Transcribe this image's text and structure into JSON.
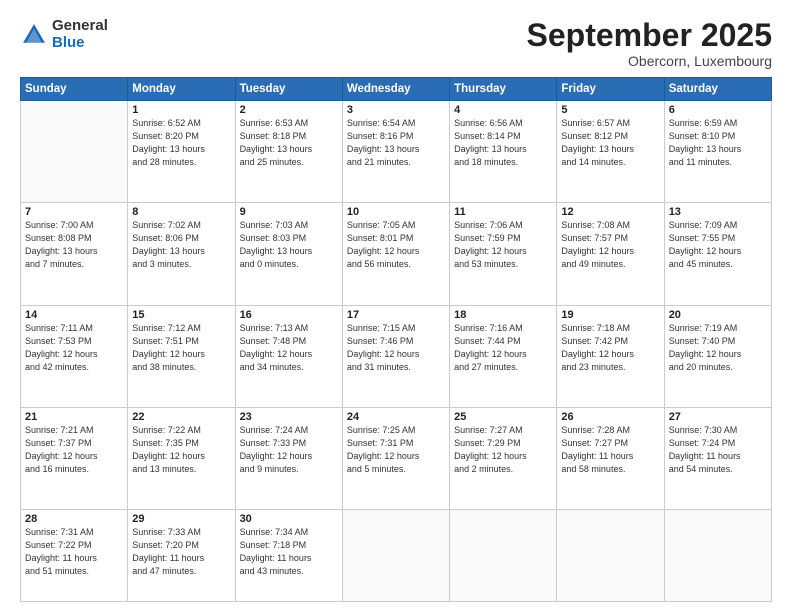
{
  "logo": {
    "general": "General",
    "blue": "Blue"
  },
  "header": {
    "month": "September 2025",
    "location": "Obercorn, Luxembourg"
  },
  "days_of_week": [
    "Sunday",
    "Monday",
    "Tuesday",
    "Wednesday",
    "Thursday",
    "Friday",
    "Saturday"
  ],
  "weeks": [
    [
      {
        "day": "",
        "info": ""
      },
      {
        "day": "1",
        "info": "Sunrise: 6:52 AM\nSunset: 8:20 PM\nDaylight: 13 hours\nand 28 minutes."
      },
      {
        "day": "2",
        "info": "Sunrise: 6:53 AM\nSunset: 8:18 PM\nDaylight: 13 hours\nand 25 minutes."
      },
      {
        "day": "3",
        "info": "Sunrise: 6:54 AM\nSunset: 8:16 PM\nDaylight: 13 hours\nand 21 minutes."
      },
      {
        "day": "4",
        "info": "Sunrise: 6:56 AM\nSunset: 8:14 PM\nDaylight: 13 hours\nand 18 minutes."
      },
      {
        "day": "5",
        "info": "Sunrise: 6:57 AM\nSunset: 8:12 PM\nDaylight: 13 hours\nand 14 minutes."
      },
      {
        "day": "6",
        "info": "Sunrise: 6:59 AM\nSunset: 8:10 PM\nDaylight: 13 hours\nand 11 minutes."
      }
    ],
    [
      {
        "day": "7",
        "info": "Sunrise: 7:00 AM\nSunset: 8:08 PM\nDaylight: 13 hours\nand 7 minutes."
      },
      {
        "day": "8",
        "info": "Sunrise: 7:02 AM\nSunset: 8:06 PM\nDaylight: 13 hours\nand 3 minutes."
      },
      {
        "day": "9",
        "info": "Sunrise: 7:03 AM\nSunset: 8:03 PM\nDaylight: 13 hours\nand 0 minutes."
      },
      {
        "day": "10",
        "info": "Sunrise: 7:05 AM\nSunset: 8:01 PM\nDaylight: 12 hours\nand 56 minutes."
      },
      {
        "day": "11",
        "info": "Sunrise: 7:06 AM\nSunset: 7:59 PM\nDaylight: 12 hours\nand 53 minutes."
      },
      {
        "day": "12",
        "info": "Sunrise: 7:08 AM\nSunset: 7:57 PM\nDaylight: 12 hours\nand 49 minutes."
      },
      {
        "day": "13",
        "info": "Sunrise: 7:09 AM\nSunset: 7:55 PM\nDaylight: 12 hours\nand 45 minutes."
      }
    ],
    [
      {
        "day": "14",
        "info": "Sunrise: 7:11 AM\nSunset: 7:53 PM\nDaylight: 12 hours\nand 42 minutes."
      },
      {
        "day": "15",
        "info": "Sunrise: 7:12 AM\nSunset: 7:51 PM\nDaylight: 12 hours\nand 38 minutes."
      },
      {
        "day": "16",
        "info": "Sunrise: 7:13 AM\nSunset: 7:48 PM\nDaylight: 12 hours\nand 34 minutes."
      },
      {
        "day": "17",
        "info": "Sunrise: 7:15 AM\nSunset: 7:46 PM\nDaylight: 12 hours\nand 31 minutes."
      },
      {
        "day": "18",
        "info": "Sunrise: 7:16 AM\nSunset: 7:44 PM\nDaylight: 12 hours\nand 27 minutes."
      },
      {
        "day": "19",
        "info": "Sunrise: 7:18 AM\nSunset: 7:42 PM\nDaylight: 12 hours\nand 23 minutes."
      },
      {
        "day": "20",
        "info": "Sunrise: 7:19 AM\nSunset: 7:40 PM\nDaylight: 12 hours\nand 20 minutes."
      }
    ],
    [
      {
        "day": "21",
        "info": "Sunrise: 7:21 AM\nSunset: 7:37 PM\nDaylight: 12 hours\nand 16 minutes."
      },
      {
        "day": "22",
        "info": "Sunrise: 7:22 AM\nSunset: 7:35 PM\nDaylight: 12 hours\nand 13 minutes."
      },
      {
        "day": "23",
        "info": "Sunrise: 7:24 AM\nSunset: 7:33 PM\nDaylight: 12 hours\nand 9 minutes."
      },
      {
        "day": "24",
        "info": "Sunrise: 7:25 AM\nSunset: 7:31 PM\nDaylight: 12 hours\nand 5 minutes."
      },
      {
        "day": "25",
        "info": "Sunrise: 7:27 AM\nSunset: 7:29 PM\nDaylight: 12 hours\nand 2 minutes."
      },
      {
        "day": "26",
        "info": "Sunrise: 7:28 AM\nSunset: 7:27 PM\nDaylight: 11 hours\nand 58 minutes."
      },
      {
        "day": "27",
        "info": "Sunrise: 7:30 AM\nSunset: 7:24 PM\nDaylight: 11 hours\nand 54 minutes."
      }
    ],
    [
      {
        "day": "28",
        "info": "Sunrise: 7:31 AM\nSunset: 7:22 PM\nDaylight: 11 hours\nand 51 minutes."
      },
      {
        "day": "29",
        "info": "Sunrise: 7:33 AM\nSunset: 7:20 PM\nDaylight: 11 hours\nand 47 minutes."
      },
      {
        "day": "30",
        "info": "Sunrise: 7:34 AM\nSunset: 7:18 PM\nDaylight: 11 hours\nand 43 minutes."
      },
      {
        "day": "",
        "info": ""
      },
      {
        "day": "",
        "info": ""
      },
      {
        "day": "",
        "info": ""
      },
      {
        "day": "",
        "info": ""
      }
    ]
  ]
}
